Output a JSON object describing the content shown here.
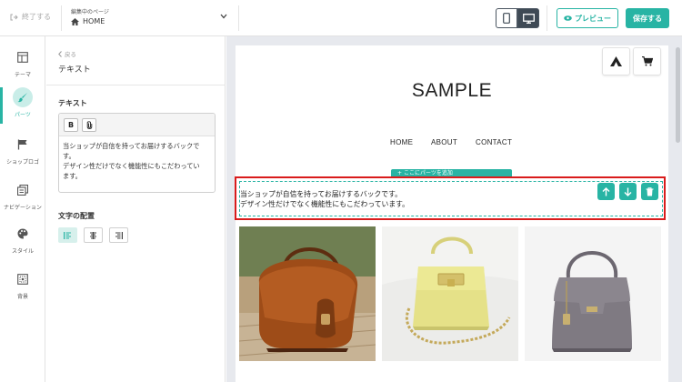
{
  "topbar": {
    "exit_label": "終了する",
    "page_select_label": "編集中のページ",
    "page_select_value": "HOME",
    "preview_label": "プレビュー",
    "save_label": "保存する"
  },
  "icon_nav": [
    {
      "label": "テーマ",
      "icon": "theme-layout-icon"
    },
    {
      "label": "パーツ",
      "icon": "brush-icon",
      "active": true
    },
    {
      "label": "ショップロゴ",
      "icon": "flag-icon"
    },
    {
      "label": "ナビゲーション",
      "icon": "navigation-icon"
    },
    {
      "label": "スタイル",
      "icon": "palette-icon"
    },
    {
      "label": "背景",
      "icon": "background-icon"
    }
  ],
  "panel": {
    "back_label": "戻る",
    "title": "テキスト",
    "text_section_label": "テキスト",
    "editor_lines": [
      "当ショップが自信を持ってお届けするバックです。",
      "デザイン性だけでなく機能性にもこだわってい",
      "ます。"
    ],
    "align_section_label": "文字の配置",
    "align_options": [
      "left",
      "center",
      "right"
    ],
    "align_selected": "left"
  },
  "site": {
    "title": "SAMPLE",
    "nav": [
      "HOME",
      "ABOUT",
      "CONTACT"
    ],
    "add_part_label": "ここにパーツを追加",
    "text_lines": [
      "当ショップが自信を持ってお届けするバックです。",
      "デザイン性だけでなく機能性にもこだわっています。"
    ],
    "products": [
      "brown-leather-bag",
      "yellow-chain-bag",
      "gray-handbag"
    ]
  },
  "colors": {
    "accent": "#28b4a4",
    "selection_outline": "#d91c1c",
    "preview_bg": "#e7e9ee",
    "device_active": "#3f4a55"
  }
}
